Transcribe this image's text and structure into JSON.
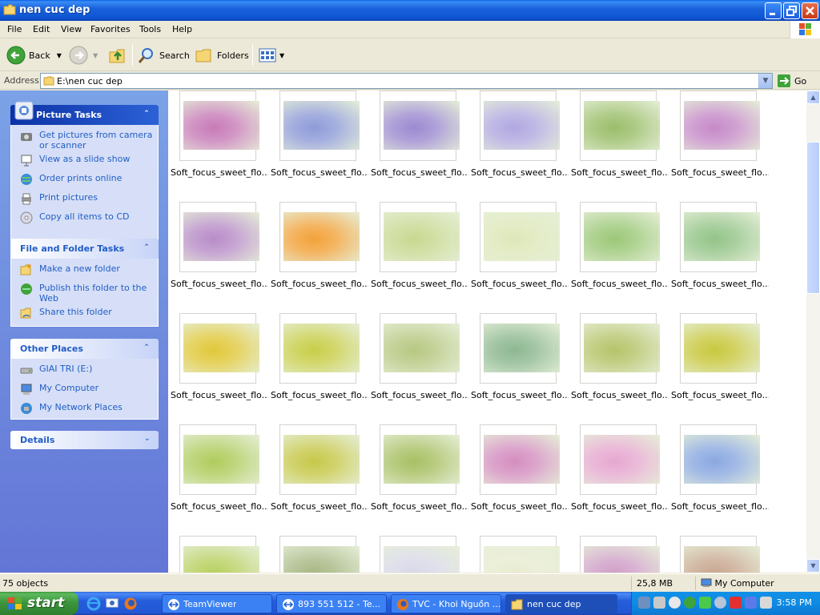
{
  "window": {
    "title": "nen cuc dep"
  },
  "menu": [
    "File",
    "Edit",
    "View",
    "Favorites",
    "Tools",
    "Help"
  ],
  "toolbar": {
    "back": "Back",
    "search": "Search",
    "folders": "Folders"
  },
  "address": {
    "label": "Address",
    "value": "E:\\nen cuc dep",
    "go": "Go"
  },
  "left": {
    "picture_tasks": {
      "title": "Picture Tasks",
      "items": [
        "Get pictures from camera or scanner",
        "View as a slide show",
        "Order prints online",
        "Print pictures",
        "Copy all items to CD"
      ]
    },
    "file_tasks": {
      "title": "File and Folder Tasks",
      "items": [
        "Make a new folder",
        "Publish this folder to the Web",
        "Share this folder"
      ]
    },
    "other_places": {
      "title": "Other Places",
      "items": [
        "GIAI TRI (E:)",
        "My Computer",
        "My Network Places"
      ]
    },
    "details": {
      "title": "Details"
    }
  },
  "thumbnails": {
    "label": "Soft_focus_sweet_flo...",
    "rows": [
      [
        {
          "c": "#C77BB8"
        },
        {
          "c": "#8E9BD8"
        },
        {
          "c": "#9C8AD0"
        },
        {
          "c": "#B0A8E0"
        },
        {
          "c": "#9BBE6A"
        },
        {
          "c": "#C58AC8"
        }
      ],
      [
        {
          "c": "#B88DC8"
        },
        {
          "c": "#F2A23A"
        },
        {
          "c": "#C8D890"
        },
        {
          "c": "#DDE7B8"
        },
        {
          "c": "#9CC878"
        },
        {
          "c": "#94C488"
        }
      ],
      [
        {
          "c": "#E0C83A"
        },
        {
          "c": "#C8CE4A"
        },
        {
          "c": "#B7C882"
        },
        {
          "c": "#8DB890"
        },
        {
          "c": "#B6C46A"
        },
        {
          "c": "#C8C840"
        }
      ],
      [
        {
          "c": "#B0CC5E"
        },
        {
          "c": "#C6C84A"
        },
        {
          "c": "#A8C064"
        },
        {
          "c": "#D48EC0"
        },
        {
          "c": "#E6A8D0"
        },
        {
          "c": "#8AA8E0"
        }
      ],
      [
        {
          "c": "#B8D060"
        },
        {
          "c": "#A8B884"
        },
        {
          "c": "#D8D8E8"
        },
        {
          "c": "#E8EBD0"
        },
        {
          "c": "#D0A0C8"
        },
        {
          "c": "#C8A890"
        }
      ]
    ]
  },
  "status": {
    "objects": "75 objects",
    "size": "25,8 MB",
    "location": "My Computer"
  },
  "taskbar": {
    "start": "start",
    "tasks": [
      "TeamViewer",
      "893 551 512 - Te...",
      "TVC - Khoi Nguồn ...",
      "nen cuc dep"
    ],
    "clock": "3:58 PM"
  }
}
